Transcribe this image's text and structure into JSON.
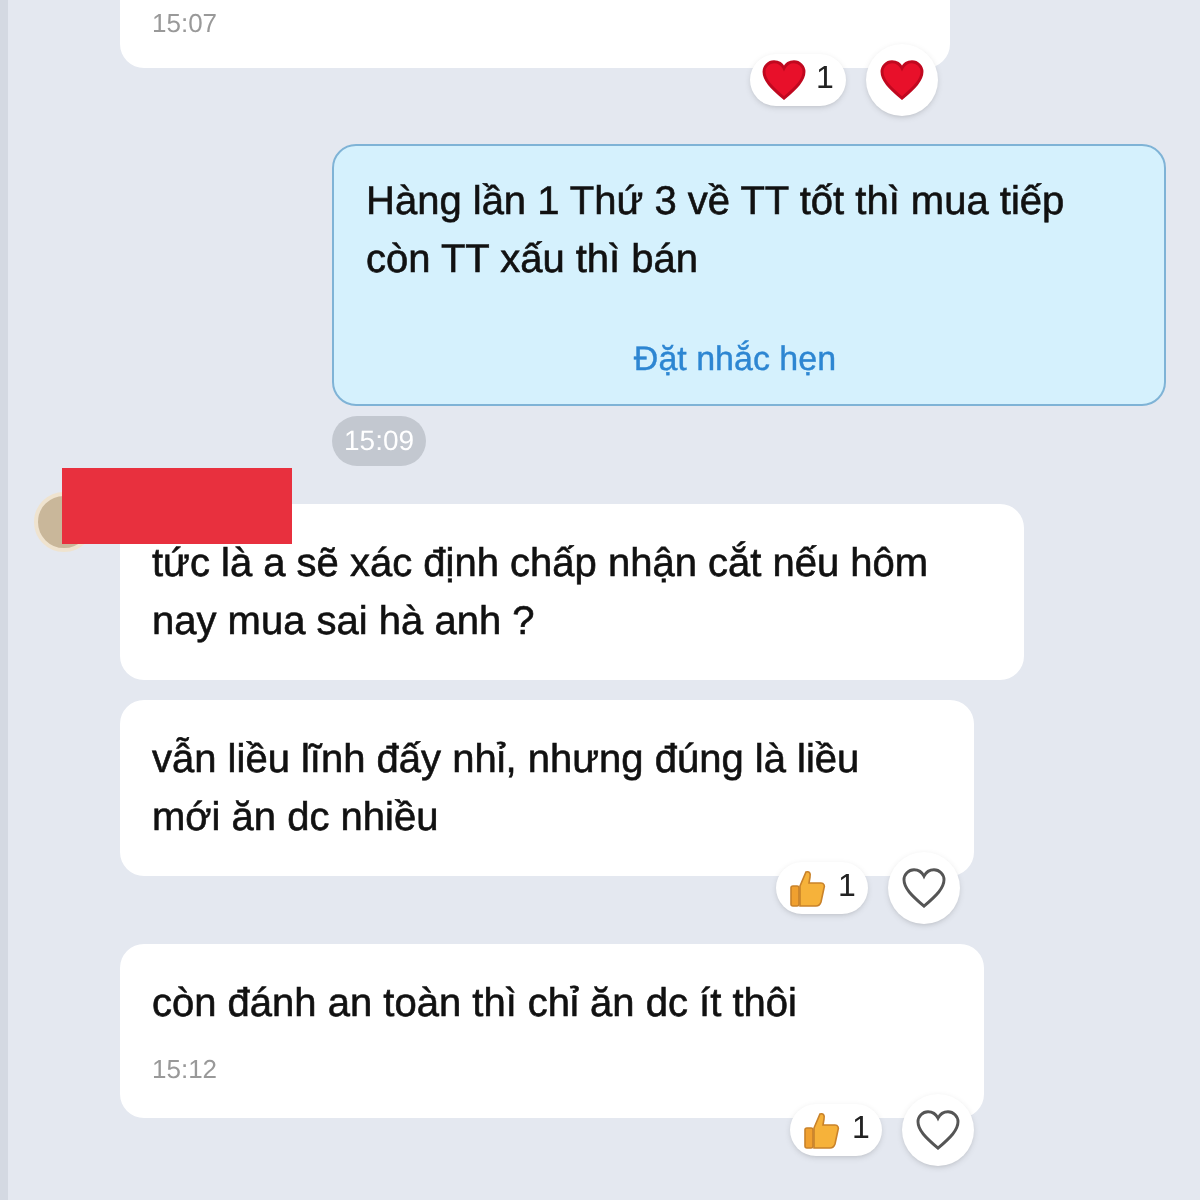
{
  "messages": [
    {
      "kind": "incoming",
      "continued": true,
      "time": "15:07",
      "reaction": {
        "kind": "heart",
        "count": "1"
      },
      "liked": true
    },
    {
      "kind": "outgoing",
      "text": "Hàng lần 1 Thứ 3 về TT tốt thì mua tiếp còn TT xấu thì bán",
      "action": "Đặt nhắc hẹn",
      "time": "15:09"
    },
    {
      "kind": "sender"
    },
    {
      "kind": "incoming",
      "text": "tức là a sẽ xác định chấp nhận cắt nếu hôm nay mua sai hà anh ?"
    },
    {
      "kind": "incoming",
      "text": "vẫn liều lĩnh đấy nhỉ, nhưng đúng là liều mới ăn dc nhiều",
      "reaction": {
        "kind": "thumbs-up",
        "count": "1"
      },
      "liked": false
    },
    {
      "kind": "incoming",
      "text": "còn đánh an toàn thì chỉ ăn dc ít thôi",
      "time": "15:12",
      "reaction": {
        "kind": "thumbs-up",
        "count": "1"
      },
      "liked": false
    }
  ]
}
